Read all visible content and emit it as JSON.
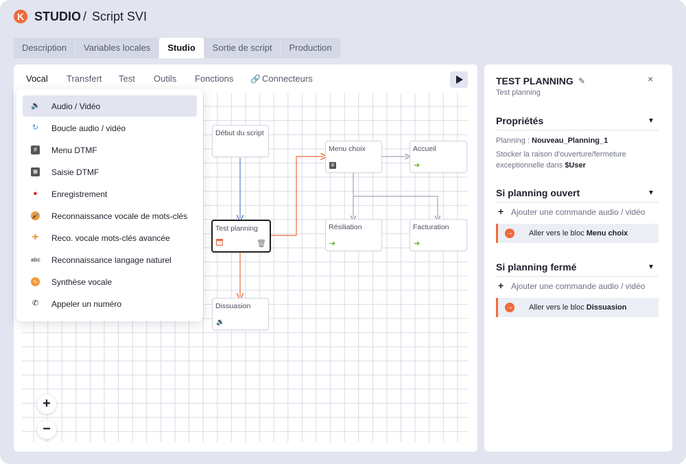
{
  "header": {
    "logo_letter": "K",
    "app_name": "STUDIO",
    "separator": "/",
    "title": "Script SVI"
  },
  "top_tabs": [
    {
      "label": "Description"
    },
    {
      "label": "Variables locales"
    },
    {
      "label": "Studio"
    },
    {
      "label": "Sortie de script"
    },
    {
      "label": "Production"
    }
  ],
  "sub_tabs": [
    {
      "label": "Vocal"
    },
    {
      "label": "Transfert"
    },
    {
      "label": "Test"
    },
    {
      "label": "Outils"
    },
    {
      "label": "Fonctions"
    },
    {
      "label": "Connecteurs"
    }
  ],
  "menu": {
    "items": [
      {
        "label": "Audio / Vidéo",
        "icon": "speaker-icon"
      },
      {
        "label": "Boucle audio / vidéo",
        "icon": "loop-icon"
      },
      {
        "label": "Menu DTMF",
        "icon": "hash-icon"
      },
      {
        "label": "Saisie DTMF",
        "icon": "keypad-icon"
      },
      {
        "label": "Enregistrement",
        "icon": "record-icon"
      },
      {
        "label": "Reconnaissance vocale de mots-clés",
        "icon": "microphone-icon"
      },
      {
        "label": "Reco. vocale mots-clés avancée",
        "icon": "microphone-plus-icon"
      },
      {
        "label": "Reconnaissance langage naturel",
        "icon": "abc-icon"
      },
      {
        "label": "Synthèse vocale",
        "icon": "waveform-icon"
      },
      {
        "label": "Appeler un numéro",
        "icon": "phone-icon"
      }
    ]
  },
  "nodes": {
    "debut": {
      "label": "Début du script"
    },
    "menu_choix": {
      "label": "Menu choix",
      "icon": "#"
    },
    "accueil": {
      "label": "Accueil"
    },
    "test_planning": {
      "label": "Test planning"
    },
    "resiliation": {
      "label": "Résiliation"
    },
    "facturation": {
      "label": "Facturation"
    },
    "dissuasion": {
      "label": "Dissuasion"
    }
  },
  "zoom": {
    "in": "+",
    "out": "−"
  },
  "panel": {
    "title": "TEST PLANNING",
    "subtitle": "Test planning",
    "close": "×",
    "proprietes": {
      "title": "Propriétés",
      "planning_label": "Planning :",
      "planning_value": "Nouveau_Planning_1",
      "stocker_text": "Stocker la raison d'ouverture/fermeture exceptionnelle dans",
      "stocker_var": "$User"
    },
    "ouvert": {
      "title": "Si planning ouvert",
      "add_label": "Ajouter une commande audio / vidéo",
      "goto_text": "Aller vers le bloc",
      "goto_block": "Menu choix"
    },
    "ferme": {
      "title": "Si planning fermé",
      "add_label": "Ajouter une commande audio / vidéo",
      "goto_text": "Aller vers le bloc",
      "goto_block": "Dissuasion"
    }
  },
  "colors": {
    "accent": "#ee6b3b",
    "edge_blue": "#5b7fbd",
    "edge_grey": "#8c90a6",
    "arrow_green": "#6ab024"
  }
}
